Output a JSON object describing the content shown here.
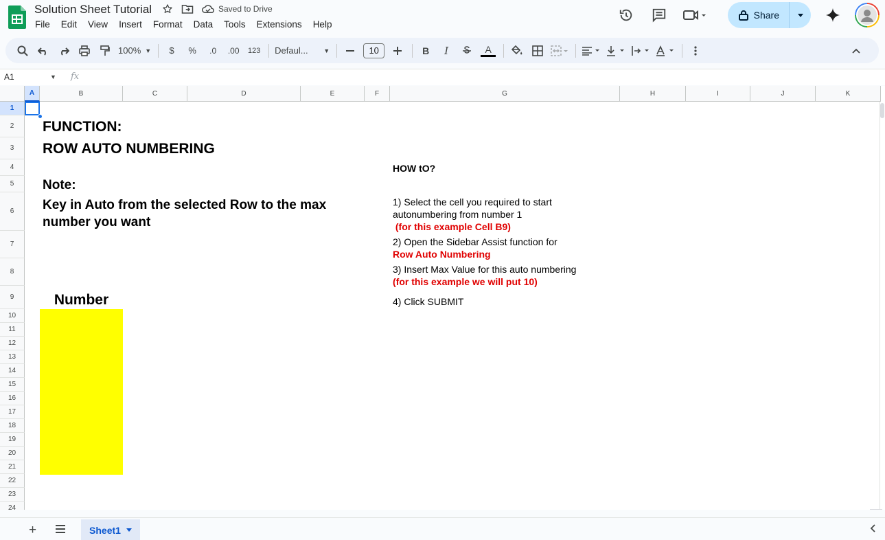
{
  "app": {
    "title": "Solution Sheet Tutorial",
    "saved_status": "Saved to Drive",
    "menu": [
      "File",
      "Edit",
      "View",
      "Insert",
      "Format",
      "Data",
      "Tools",
      "Extensions",
      "Help"
    ],
    "share_label": "Share",
    "colors": {
      "accent": "#0b57d0",
      "share_bg": "#c2e7ff",
      "highlight": "#ffff00",
      "red_text": "#e00000"
    }
  },
  "toolbar": {
    "zoom": "100%",
    "currency": "$",
    "percent": "%",
    "dec_decrease": ".0",
    "dec_increase": ".00",
    "number_format": "123",
    "font": "Defaul...",
    "font_size": "10",
    "bold": "B",
    "italic": "I",
    "text_color": "A"
  },
  "formula_bar": {
    "cell_ref": "A1",
    "fx": "fx",
    "value": ""
  },
  "columns": [
    "A",
    "B",
    "C",
    "D",
    "E",
    "F",
    "G",
    "H",
    "I",
    "J",
    "K"
  ],
  "rows": [
    "1",
    "2",
    "3",
    "4",
    "5",
    "6",
    "7",
    "8",
    "9",
    "10",
    "11",
    "12",
    "13",
    "14",
    "15",
    "16",
    "17",
    "18",
    "19",
    "20",
    "21",
    "22",
    "23",
    "24"
  ],
  "sheet_content": {
    "function_label": "FUNCTION:",
    "function_name": "ROW AUTO NUMBERING",
    "note_label": "Note:",
    "note_body": "Key in Auto from the selected Row to the max number you want",
    "number_header": "Number",
    "howto_title": "HOW tO?",
    "step1_line1": "1) Select the cell you required to start",
    "step1_line2": "autonumbering from number 1",
    "step1_red": " (for this example Cell B9)",
    "step2_line1": "2) Open the Sidebar Assist function for",
    "step2_red": "Row Auto Numbering",
    "step3_line1": "3) Insert Max Value for this auto numbering",
    "step3_red": "(for this example we will put 10)",
    "step4": "4) Click SUBMIT"
  },
  "sheet_tabs": {
    "active": "Sheet1"
  }
}
